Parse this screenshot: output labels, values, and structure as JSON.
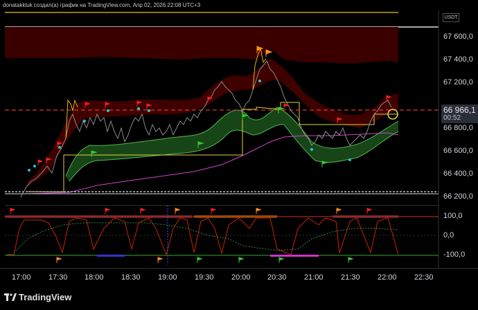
{
  "header": {
    "title": "donatakkluk создал(а) график на TradingView.com, Апр 02, 2026 22:08 UTC+3"
  },
  "price_scale": {
    "unit": "USDT",
    "ticks": [
      "67 600,0",
      "67 400,0",
      "67 200,0",
      "66 800,0",
      "66 600,0",
      "66 400,0",
      "66 200,0"
    ],
    "current_price": "66 966,1",
    "countdown": "00:52"
  },
  "indicator_scale": {
    "ticks": [
      "100,0",
      "0,0",
      "-100,0"
    ]
  },
  "time_axis": {
    "ticks": [
      "17:00",
      "17:30",
      "18:00",
      "18:30",
      "19:00",
      "19:30",
      "20:00",
      "20:30",
      "21:00",
      "21:30",
      "22:00",
      "22:30"
    ]
  },
  "footer": {
    "brand": "TradingView"
  },
  "colors": {
    "background": "#000000",
    "up": "#f7b500",
    "down": "#808080",
    "bear_band": "#5a0000",
    "bull_band": "#1f5f1f",
    "osc_line": "#cc2200"
  }
}
